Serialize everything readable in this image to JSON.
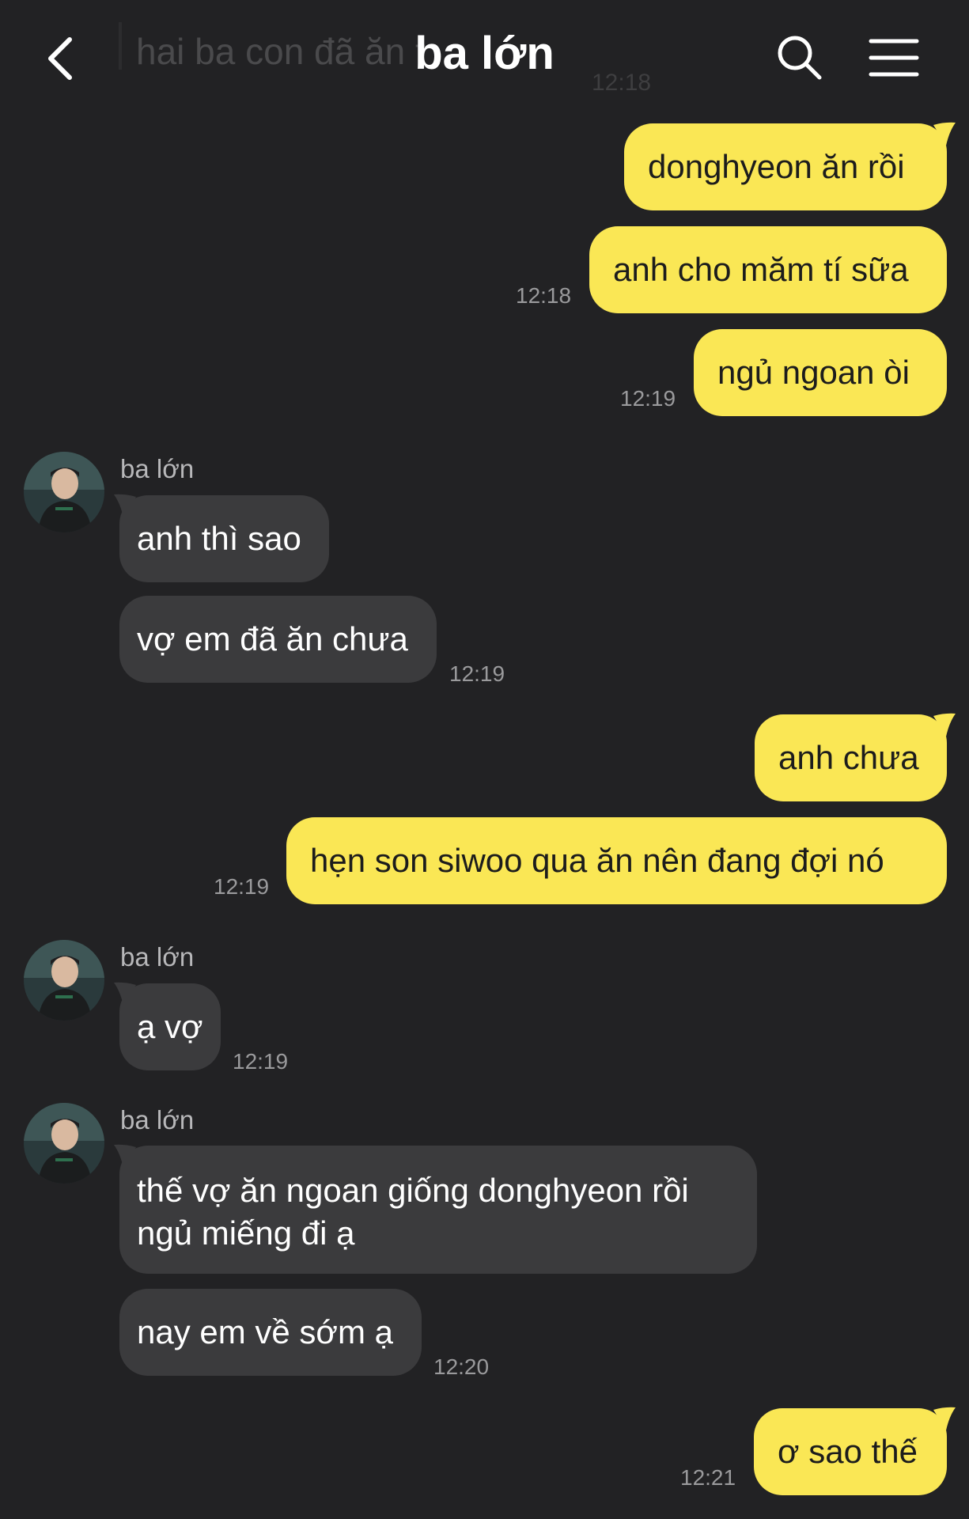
{
  "header": {
    "title": "ba lớn",
    "ghost_preview": "hai ba con đã ăn t",
    "ghost_time": "12:18"
  },
  "colors": {
    "background": "#222224",
    "outgoing_bubble": "#fae755",
    "incoming_bubble": "#3b3b3d",
    "timestamp": "#9a9a9c"
  },
  "icons": {
    "back": "chevron-left-icon",
    "search": "search-icon",
    "menu": "hamburger-menu-icon"
  },
  "messages": {
    "out1": "donghyeon ăn rồi",
    "out2": "anh cho măm tí sữa",
    "out2_time": "12:18",
    "out3": "ngủ ngoan òi",
    "out3_time": "12:19",
    "group1_sender": "ba lớn",
    "in1": "anh thì sao",
    "in2": "vợ em đã ăn chưa",
    "in2_time": "12:19",
    "out4": "anh chưa",
    "out5": "hẹn son siwoo qua ăn nên đang đợi nó",
    "out5_time": "12:19",
    "group2_sender": "ba lớn",
    "in3": "ạ vợ",
    "in3_time": "12:19",
    "group3_sender": "ba lớn",
    "in4": "thế vợ ăn ngoan giống donghyeon rồi ngủ miếng đi ạ",
    "in5": "nay em về sớm ạ",
    "in5_time": "12:20",
    "out6": "ơ sao thế",
    "out6_time": "12:21"
  }
}
